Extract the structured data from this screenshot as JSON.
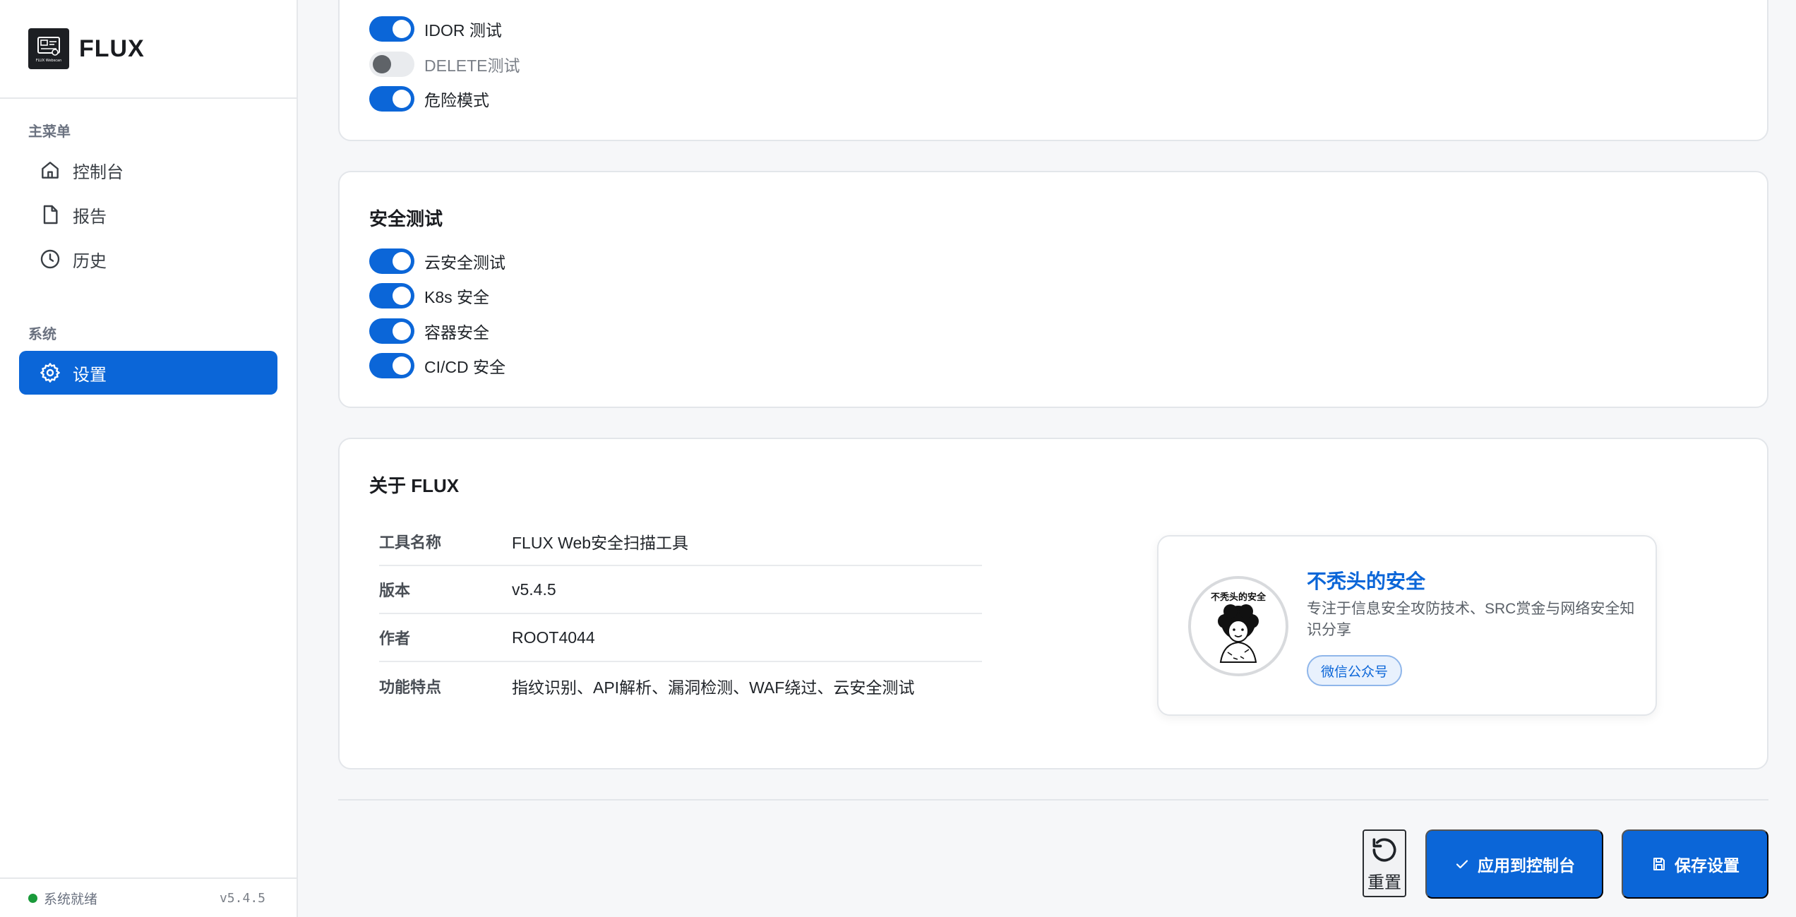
{
  "brand": {
    "name": "FLUX",
    "logo_caption": "FLUX Webscan"
  },
  "sidebar": {
    "main_menu_title": "主菜单",
    "main_items": [
      {
        "label": "控制台",
        "icon": "home-icon"
      },
      {
        "label": "报告",
        "icon": "document-icon"
      },
      {
        "label": "历史",
        "icon": "clock-icon"
      }
    ],
    "system_title": "系统",
    "system_items": [
      {
        "label": "设置",
        "icon": "gear-icon",
        "active": true
      }
    ],
    "status_text": "系统就绪",
    "version": "v5.4.5"
  },
  "top_card": {
    "toggles": [
      {
        "label": "IDOR 测试",
        "on": true
      },
      {
        "label": "DELETE测试",
        "on": false
      },
      {
        "label": "危险模式",
        "on": true
      }
    ]
  },
  "security_card": {
    "title": "安全测试",
    "toggles": [
      {
        "label": "云安全测试",
        "on": true
      },
      {
        "label": "K8s 安全",
        "on": true
      },
      {
        "label": "容器安全",
        "on": true
      },
      {
        "label": "CI/CD 安全",
        "on": true
      }
    ]
  },
  "about_card": {
    "title": "关于 FLUX",
    "rows": [
      {
        "label": "工具名称",
        "value": "FLUX Web安全扫描工具"
      },
      {
        "label": "版本",
        "value": "v5.4.5"
      },
      {
        "label": "作者",
        "value": "ROOT4044"
      },
      {
        "label": "功能特点",
        "value": "指纹识别、API解析、漏洞检测、WAF绕过、云安全测试"
      }
    ],
    "promo": {
      "avatar_text": "不秃头的安全",
      "title": "不秃头的安全",
      "description": "专注于信息安全攻防技术、SRC赏金与网络安全知识分享",
      "tag": "微信公众号"
    }
  },
  "actions": {
    "reset_label": "重置",
    "apply_label": "应用到控制台",
    "save_label": "保存设置"
  },
  "colors": {
    "accent": "#0b66d8",
    "status_ok": "#1a9a3a"
  }
}
